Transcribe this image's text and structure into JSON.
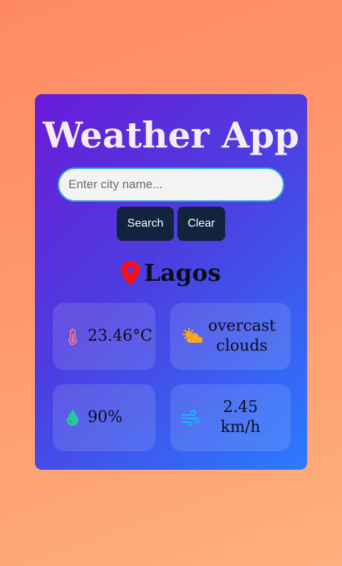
{
  "app": {
    "title": "Weather App"
  },
  "search": {
    "placeholder": "Enter city name...",
    "value": "",
    "search_label": "Search",
    "clear_label": "Clear"
  },
  "location": {
    "city": "Lagos",
    "icon": "map-pin-icon"
  },
  "stats": {
    "temperature": {
      "value": "23.46°C",
      "icon": "thermometer-icon",
      "color": "#f07a92"
    },
    "condition": {
      "value": "overcast clouds",
      "icon": "sun-cloud-icon",
      "color": "#f6a623"
    },
    "humidity": {
      "value": "90%",
      "icon": "droplet-icon",
      "color": "#27c99a"
    },
    "wind": {
      "value": "2.45 km/h",
      "icon": "wind-icon",
      "color": "#1fb6f2"
    }
  },
  "colors": {
    "accent_button": "#10243d",
    "input_border": "#2ea6e6",
    "pin": "#ff0d14"
  }
}
